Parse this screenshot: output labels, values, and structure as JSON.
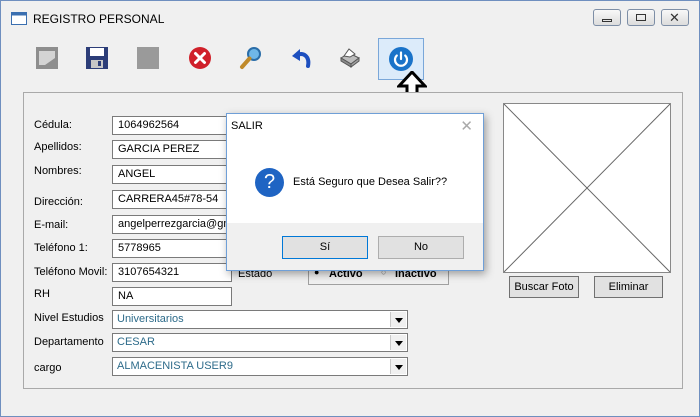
{
  "window": {
    "title": "REGISTRO PERSONAL"
  },
  "toolbar": {
    "buttons": [
      {
        "name": "new",
        "icon": "new-document-icon"
      },
      {
        "name": "save",
        "icon": "floppy-disk-icon"
      },
      {
        "name": "blank",
        "icon": "gray-square-icon"
      },
      {
        "name": "delete",
        "icon": "red-x-icon"
      },
      {
        "name": "search",
        "icon": "magnifier-icon"
      },
      {
        "name": "undo",
        "icon": "undo-arrow-icon"
      },
      {
        "name": "print",
        "icon": "printer-icon"
      },
      {
        "name": "exit",
        "icon": "power-icon"
      }
    ]
  },
  "form": {
    "cedula": {
      "label": "Cédula:",
      "value": "1064962564"
    },
    "apellidos": {
      "label": "Apellidos:",
      "value": "GARCIA PEREZ"
    },
    "nombres": {
      "label": "Nombres:",
      "value": "ANGEL"
    },
    "direccion": {
      "label": "Dirección:",
      "value": "CARRERA45#78-54"
    },
    "email": {
      "label": "E-mail:",
      "value": "angelperrezgarcia@gm"
    },
    "telefono1": {
      "label": "Teléfono 1:",
      "value": "5778965"
    },
    "telefono_movil": {
      "label": "Teléfono Movil:",
      "value": "3107654321"
    },
    "rh": {
      "label": "RH",
      "value": "NA"
    },
    "nivel_estudios": {
      "label": "Nivel Estudios",
      "value": "Universitarios"
    },
    "departamento": {
      "label": "Departamento",
      "value": "CESAR"
    },
    "cargo": {
      "label": "cargo",
      "value": "ALMACENISTA USER9"
    },
    "estado": {
      "label": "Estado",
      "activo": "Activo",
      "inactivo": "Inactivo",
      "selected": "Activo"
    }
  },
  "photo": {
    "buscar_label": "Buscar Foto",
    "eliminar_label": "Eliminar"
  },
  "dialog": {
    "title": "SALIR",
    "message": "Está Seguro que Desea Salir??",
    "yes_label": "Sí",
    "no_label": "No"
  },
  "colors": {
    "dialog_icon": "#1f64c3",
    "accent": "#0078d7"
  }
}
